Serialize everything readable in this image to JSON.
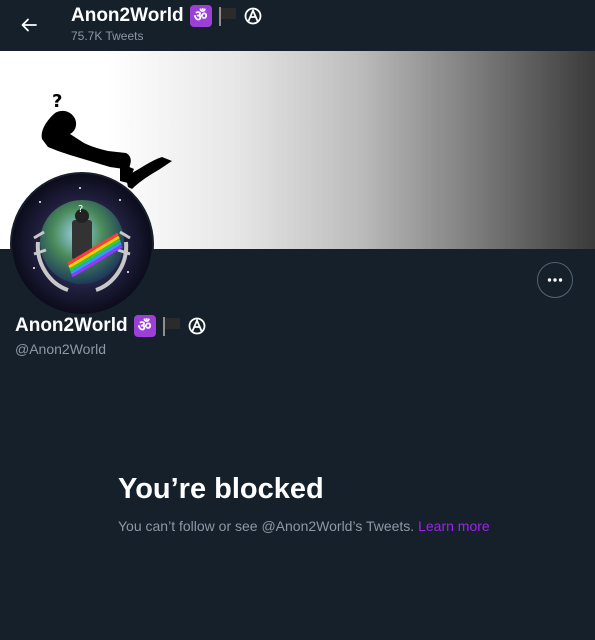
{
  "header": {
    "name": "Anon2World",
    "tweet_count": "75.7K Tweets",
    "om_emoji": "ॐ"
  },
  "icons": {
    "back": "arrow-left-icon",
    "om": "om-icon",
    "flag": "black-flag-icon",
    "anarchy": "anarchy-icon",
    "more": "more-horizontal-icon"
  },
  "profile": {
    "name": "Anon2World",
    "handle": "@Anon2World",
    "om_emoji": "ॐ"
  },
  "blocked": {
    "title": "You’re blocked",
    "message": "You can’t follow or see @Anon2World’s Tweets. ",
    "link": "Learn more"
  },
  "colors": {
    "background": "#15202b",
    "secondary_text": "#8b98a5",
    "link": "#a020f0",
    "om_badge": "#9c3fd6"
  }
}
